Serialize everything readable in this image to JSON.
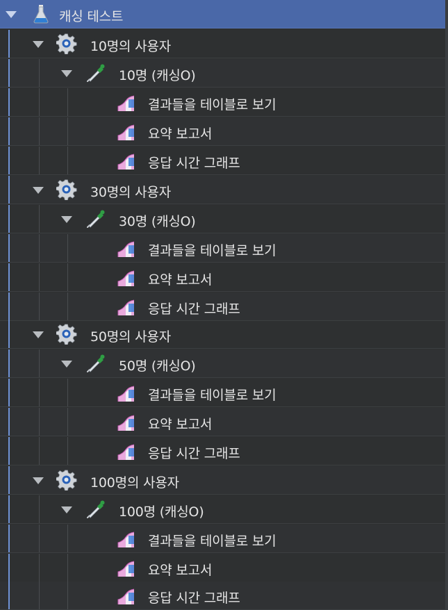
{
  "tree": {
    "root": {
      "label": "캐싱 테스트",
      "icon": "flask-icon"
    },
    "groups": [
      {
        "label": "10명의 사용자",
        "icon": "gear-icon",
        "sampler": {
          "label": "10명 (캐싱O)",
          "icon": "pipette-icon"
        },
        "listeners": [
          "결과들을 테이블로 보기",
          "요약 보고서",
          "응답 시간 그래프"
        ]
      },
      {
        "label": "30명의 사용자",
        "icon": "gear-icon",
        "sampler": {
          "label": "30명 (캐싱O)",
          "icon": "pipette-icon"
        },
        "listeners": [
          "결과들을 테이블로 보기",
          "요약 보고서",
          "응답 시간 그래프"
        ]
      },
      {
        "label": "50명의 사용자",
        "icon": "gear-icon",
        "sampler": {
          "label": "50명 (캐싱O)",
          "icon": "pipette-icon"
        },
        "listeners": [
          "결과들을 테이블로 보기",
          "요약 보고서",
          "응답 시간 그래프"
        ]
      },
      {
        "label": "100명의 사용자",
        "icon": "gear-icon",
        "sampler": {
          "label": "100명 (캐싱O)",
          "icon": "pipette-icon"
        },
        "listeners": [
          "결과들을 테이블로 보기",
          "요약 보고서",
          "응답 시간 그래프"
        ]
      }
    ],
    "listener_icon": "graph-listener-icon",
    "colors": {
      "selected": "#4a68a8",
      "background": "#2e3031",
      "text": "#e6e6e6"
    }
  }
}
